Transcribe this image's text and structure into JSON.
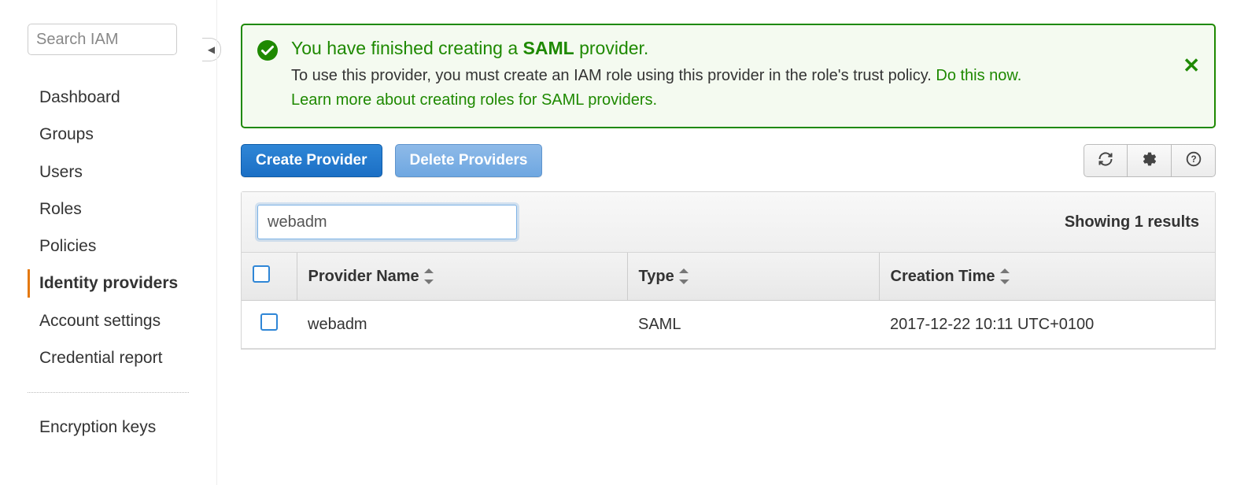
{
  "sidebar": {
    "search_placeholder": "Search IAM",
    "items": [
      {
        "label": "Dashboard"
      },
      {
        "label": "Groups"
      },
      {
        "label": "Users"
      },
      {
        "label": "Roles"
      },
      {
        "label": "Policies"
      },
      {
        "label": "Identity providers",
        "active": true
      },
      {
        "label": "Account settings"
      },
      {
        "label": "Credential report"
      }
    ],
    "secondary": [
      {
        "label": "Encryption keys"
      }
    ]
  },
  "alert": {
    "title_pre": "You have finished creating a ",
    "title_bold": "SAML",
    "title_post": " provider.",
    "body": "To use this provider, you must create an IAM role using this provider in the role's trust policy. ",
    "link1": "Do this now.",
    "link2": "Learn more about creating roles for SAML providers."
  },
  "toolbar": {
    "create_label": "Create Provider",
    "delete_label": "Delete Providers"
  },
  "filter": {
    "value": "webadm",
    "results_text": "Showing 1 results"
  },
  "table": {
    "headers": {
      "provider_name": "Provider Name",
      "type": "Type",
      "creation_time": "Creation Time"
    },
    "rows": [
      {
        "name": "webadm",
        "type": "SAML",
        "created": "2017-12-22 10:11 UTC+0100"
      }
    ]
  }
}
